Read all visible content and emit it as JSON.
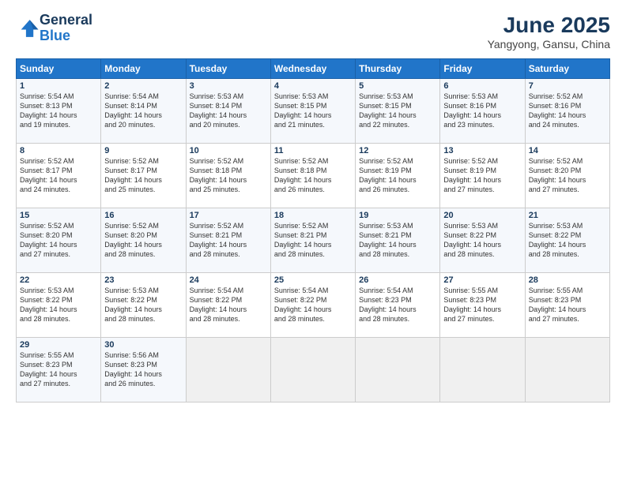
{
  "header": {
    "logo_line1": "General",
    "logo_line2": "Blue",
    "month_title": "June 2025",
    "location": "Yangyong, Gansu, China"
  },
  "days_of_week": [
    "Sunday",
    "Monday",
    "Tuesday",
    "Wednesday",
    "Thursday",
    "Friday",
    "Saturday"
  ],
  "weeks": [
    [
      {
        "day": "1",
        "text": "Sunrise: 5:54 AM\nSunset: 8:13 PM\nDaylight: 14 hours\nand 19 minutes."
      },
      {
        "day": "2",
        "text": "Sunrise: 5:54 AM\nSunset: 8:14 PM\nDaylight: 14 hours\nand 20 minutes."
      },
      {
        "day": "3",
        "text": "Sunrise: 5:53 AM\nSunset: 8:14 PM\nDaylight: 14 hours\nand 20 minutes."
      },
      {
        "day": "4",
        "text": "Sunrise: 5:53 AM\nSunset: 8:15 PM\nDaylight: 14 hours\nand 21 minutes."
      },
      {
        "day": "5",
        "text": "Sunrise: 5:53 AM\nSunset: 8:15 PM\nDaylight: 14 hours\nand 22 minutes."
      },
      {
        "day": "6",
        "text": "Sunrise: 5:53 AM\nSunset: 8:16 PM\nDaylight: 14 hours\nand 23 minutes."
      },
      {
        "day": "7",
        "text": "Sunrise: 5:52 AM\nSunset: 8:16 PM\nDaylight: 14 hours\nand 24 minutes."
      }
    ],
    [
      {
        "day": "8",
        "text": "Sunrise: 5:52 AM\nSunset: 8:17 PM\nDaylight: 14 hours\nand 24 minutes."
      },
      {
        "day": "9",
        "text": "Sunrise: 5:52 AM\nSunset: 8:17 PM\nDaylight: 14 hours\nand 25 minutes."
      },
      {
        "day": "10",
        "text": "Sunrise: 5:52 AM\nSunset: 8:18 PM\nDaylight: 14 hours\nand 25 minutes."
      },
      {
        "day": "11",
        "text": "Sunrise: 5:52 AM\nSunset: 8:18 PM\nDaylight: 14 hours\nand 26 minutes."
      },
      {
        "day": "12",
        "text": "Sunrise: 5:52 AM\nSunset: 8:19 PM\nDaylight: 14 hours\nand 26 minutes."
      },
      {
        "day": "13",
        "text": "Sunrise: 5:52 AM\nSunset: 8:19 PM\nDaylight: 14 hours\nand 27 minutes."
      },
      {
        "day": "14",
        "text": "Sunrise: 5:52 AM\nSunset: 8:20 PM\nDaylight: 14 hours\nand 27 minutes."
      }
    ],
    [
      {
        "day": "15",
        "text": "Sunrise: 5:52 AM\nSunset: 8:20 PM\nDaylight: 14 hours\nand 27 minutes."
      },
      {
        "day": "16",
        "text": "Sunrise: 5:52 AM\nSunset: 8:20 PM\nDaylight: 14 hours\nand 28 minutes."
      },
      {
        "day": "17",
        "text": "Sunrise: 5:52 AM\nSunset: 8:21 PM\nDaylight: 14 hours\nand 28 minutes."
      },
      {
        "day": "18",
        "text": "Sunrise: 5:52 AM\nSunset: 8:21 PM\nDaylight: 14 hours\nand 28 minutes."
      },
      {
        "day": "19",
        "text": "Sunrise: 5:53 AM\nSunset: 8:21 PM\nDaylight: 14 hours\nand 28 minutes."
      },
      {
        "day": "20",
        "text": "Sunrise: 5:53 AM\nSunset: 8:22 PM\nDaylight: 14 hours\nand 28 minutes."
      },
      {
        "day": "21",
        "text": "Sunrise: 5:53 AM\nSunset: 8:22 PM\nDaylight: 14 hours\nand 28 minutes."
      }
    ],
    [
      {
        "day": "22",
        "text": "Sunrise: 5:53 AM\nSunset: 8:22 PM\nDaylight: 14 hours\nand 28 minutes."
      },
      {
        "day": "23",
        "text": "Sunrise: 5:53 AM\nSunset: 8:22 PM\nDaylight: 14 hours\nand 28 minutes."
      },
      {
        "day": "24",
        "text": "Sunrise: 5:54 AM\nSunset: 8:22 PM\nDaylight: 14 hours\nand 28 minutes."
      },
      {
        "day": "25",
        "text": "Sunrise: 5:54 AM\nSunset: 8:22 PM\nDaylight: 14 hours\nand 28 minutes."
      },
      {
        "day": "26",
        "text": "Sunrise: 5:54 AM\nSunset: 8:23 PM\nDaylight: 14 hours\nand 28 minutes."
      },
      {
        "day": "27",
        "text": "Sunrise: 5:55 AM\nSunset: 8:23 PM\nDaylight: 14 hours\nand 27 minutes."
      },
      {
        "day": "28",
        "text": "Sunrise: 5:55 AM\nSunset: 8:23 PM\nDaylight: 14 hours\nand 27 minutes."
      }
    ],
    [
      {
        "day": "29",
        "text": "Sunrise: 5:55 AM\nSunset: 8:23 PM\nDaylight: 14 hours\nand 27 minutes."
      },
      {
        "day": "30",
        "text": "Sunrise: 5:56 AM\nSunset: 8:23 PM\nDaylight: 14 hours\nand 26 minutes."
      },
      {
        "day": "",
        "text": ""
      },
      {
        "day": "",
        "text": ""
      },
      {
        "day": "",
        "text": ""
      },
      {
        "day": "",
        "text": ""
      },
      {
        "day": "",
        "text": ""
      }
    ]
  ]
}
